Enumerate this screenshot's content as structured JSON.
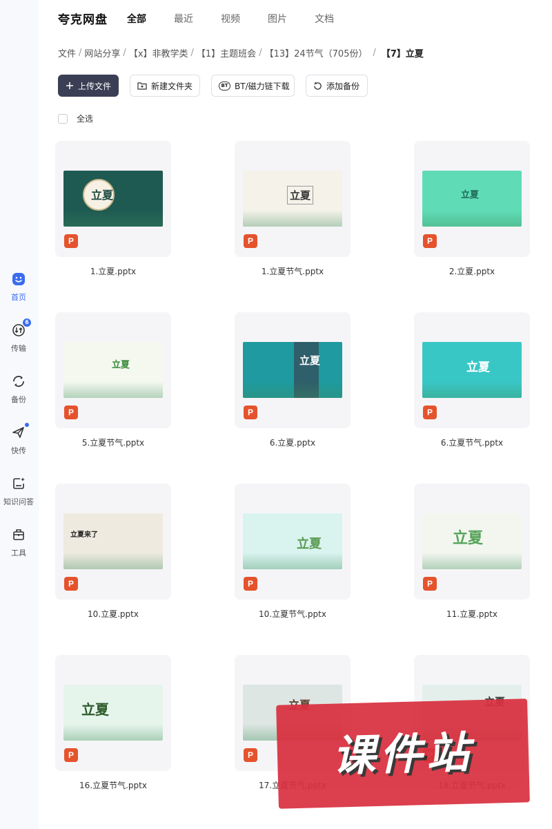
{
  "brand": "夸克网盘",
  "top_tabs": [
    "全部",
    "最近",
    "视频",
    "图片",
    "文档"
  ],
  "breadcrumb": [
    "文件",
    "网站分享",
    "【x】非教学类",
    "【1】主题班会",
    "【13】24节气（705份）",
    "【7】立夏"
  ],
  "toolbar": {
    "upload": "上传文件",
    "new_folder": "新建文件夹",
    "bt_download": "BT/磁力链下载",
    "add_backup": "添加备份",
    "bt_badge": "BT"
  },
  "select_all": "全选",
  "sidebar": [
    {
      "label": "首页",
      "icon": "home-icon",
      "active": true
    },
    {
      "label": "传输",
      "icon": "transfer-icon",
      "badge": "6"
    },
    {
      "label": "备份",
      "icon": "backup-icon"
    },
    {
      "label": "快传",
      "icon": "quick-send-icon",
      "dot": true
    },
    {
      "label": "知识问答",
      "icon": "knowledge-icon"
    },
    {
      "label": "工具",
      "icon": "toolbox-icon"
    }
  ],
  "files": [
    {
      "name": "1.立夏.pptx",
      "slide_text": "立夏",
      "bg": "#1f5a52"
    },
    {
      "name": "1.立夏节气.pptx",
      "slide_text": "立夏",
      "bg": "#f5f2ea"
    },
    {
      "name": "2.立夏.pptx",
      "slide_text": "立夏",
      "bg": "#5fdcb6"
    },
    {
      "name": "5.立夏节气.pptx",
      "slide_text": "立夏",
      "bg": "#f4f8ef"
    },
    {
      "name": "6.立夏.pptx",
      "slide_text": "立夏",
      "bg": "#1e9aa0"
    },
    {
      "name": "6.立夏节气.pptx",
      "slide_text": "立夏",
      "bg": "#39c7c6"
    },
    {
      "name": "10.立夏.pptx",
      "slide_text": "立夏来了",
      "bg": "#eeeae0"
    },
    {
      "name": "10.立夏节气.pptx",
      "slide_text": "立夏",
      "bg": "#d9f3ef"
    },
    {
      "name": "11.立夏.pptx",
      "slide_text": "立夏",
      "bg": "#f2f6ee"
    },
    {
      "name": "16.立夏节气.pptx",
      "slide_text": "立夏",
      "bg": "#e6f5ec"
    },
    {
      "name": "17.立夏节气.pptx",
      "slide_text": "立夏",
      "bg": "#dde6e2"
    },
    {
      "name": "18.立夏节气.pptx",
      "slide_text": "立夏",
      "bg": "#e4efec"
    }
  ],
  "file_type_badge": "P",
  "watermark": "课件站",
  "colors": {
    "accent": "#3a6cf0",
    "ppt": "#e5532d",
    "primary_button": "#3a3f55",
    "watermark": "#d9303f"
  }
}
